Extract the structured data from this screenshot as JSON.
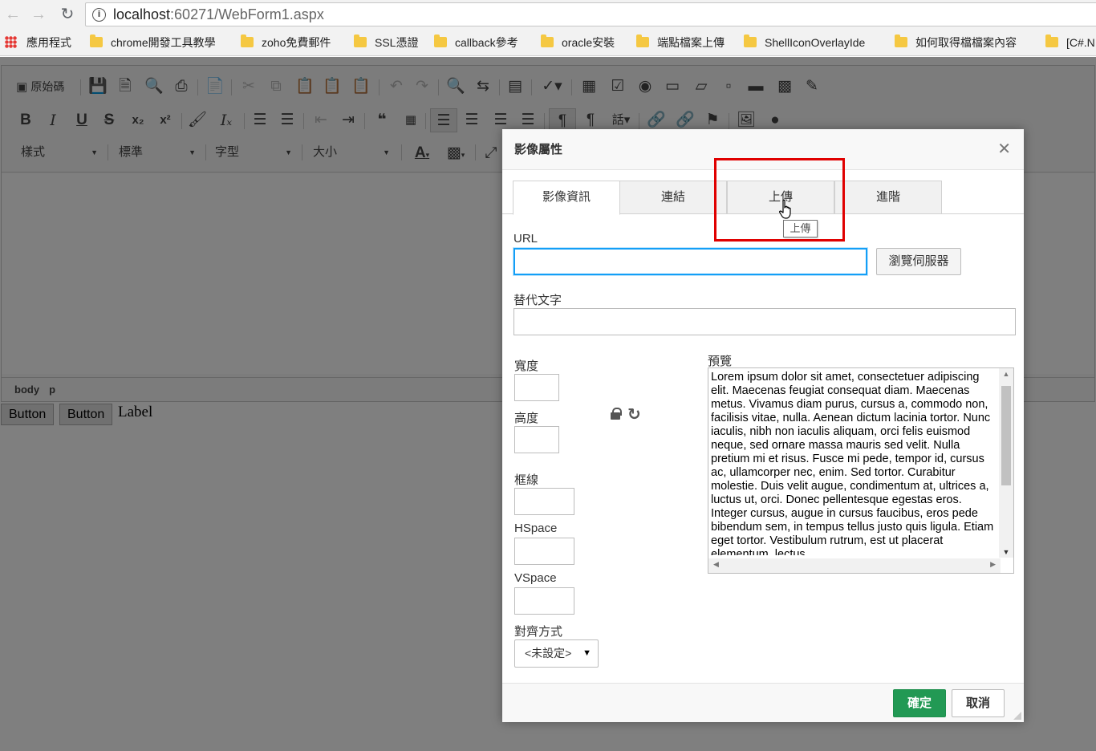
{
  "browser": {
    "url_host": "localhost",
    "url_path": ":60271/WebForm1.aspx",
    "bookmarks": [
      {
        "label": "應用程式",
        "icon": "apps-icon"
      },
      {
        "label": "chrome開發工具教學",
        "icon": "folder-icon"
      },
      {
        "label": "zoho免費郵件",
        "icon": "folder-icon"
      },
      {
        "label": "SSL憑證",
        "icon": "folder-icon"
      },
      {
        "label": "callback參考",
        "icon": "folder-icon"
      },
      {
        "label": "oracle安裝",
        "icon": "folder-icon"
      },
      {
        "label": "端點檔案上傳",
        "icon": "folder-icon"
      },
      {
        "label": "ShellIconOverlayIde",
        "icon": "folder-icon"
      },
      {
        "label": "如何取得檔檔案內容",
        "icon": "folder-icon"
      },
      {
        "label": "[C#.N",
        "icon": "folder-icon"
      }
    ]
  },
  "editor": {
    "source_label": "原始碼",
    "combos": {
      "styles": "樣式",
      "format": "標準",
      "font": "字型",
      "size": "大小"
    },
    "path": [
      "body",
      "p"
    ]
  },
  "page": {
    "button1": "Button",
    "button2": "Button",
    "label": "Label"
  },
  "dialog": {
    "title": "影像屬性",
    "tabs": [
      {
        "label": "影像資訊",
        "active": true
      },
      {
        "label": "連結",
        "active": false
      },
      {
        "label": "上傳",
        "active": false
      },
      {
        "label": "進階",
        "active": false
      }
    ],
    "url_label": "URL",
    "url_value": "",
    "browse_server_label": "瀏覽伺服器",
    "alt_label": "替代文字",
    "alt_value": "",
    "width_label": "寬度",
    "height_label": "高度",
    "border_label": "框線",
    "hspace_label": "HSpace",
    "vspace_label": "VSpace",
    "align_label": "對齊方式",
    "align_value": "<未設定>",
    "preview_label": "預覽",
    "preview_text": "Lorem ipsum dolor sit amet, consectetuer adipiscing elit. Maecenas feugiat consequat diam. Maecenas metus. Vivamus diam purus, cursus a, commodo non, facilisis vitae, nulla. Aenean dictum lacinia tortor. Nunc iaculis, nibh non iaculis aliquam, orci felis euismod neque, sed ornare massa mauris sed velit. Nulla pretium mi et risus. Fusce mi pede, tempor id, cursus ac, ullamcorper nec, enim. Sed tortor. Curabitur molestie. Duis velit augue, condimentum at, ultrices a, luctus ut, orci. Donec pellentesque egestas eros. Integer cursus, augue in cursus faucibus, eros pede bibendum sem, in tempus tellus justo quis ligula. Etiam eget tortor. Vestibulum rutrum, est ut placerat elementum, lectus",
    "ok_label": "確定",
    "cancel_label": "取消",
    "tooltip": "上傳"
  },
  "colors": {
    "ok_button": "#229954",
    "url_focus": "#139ff7",
    "annotation": "#e00000"
  }
}
